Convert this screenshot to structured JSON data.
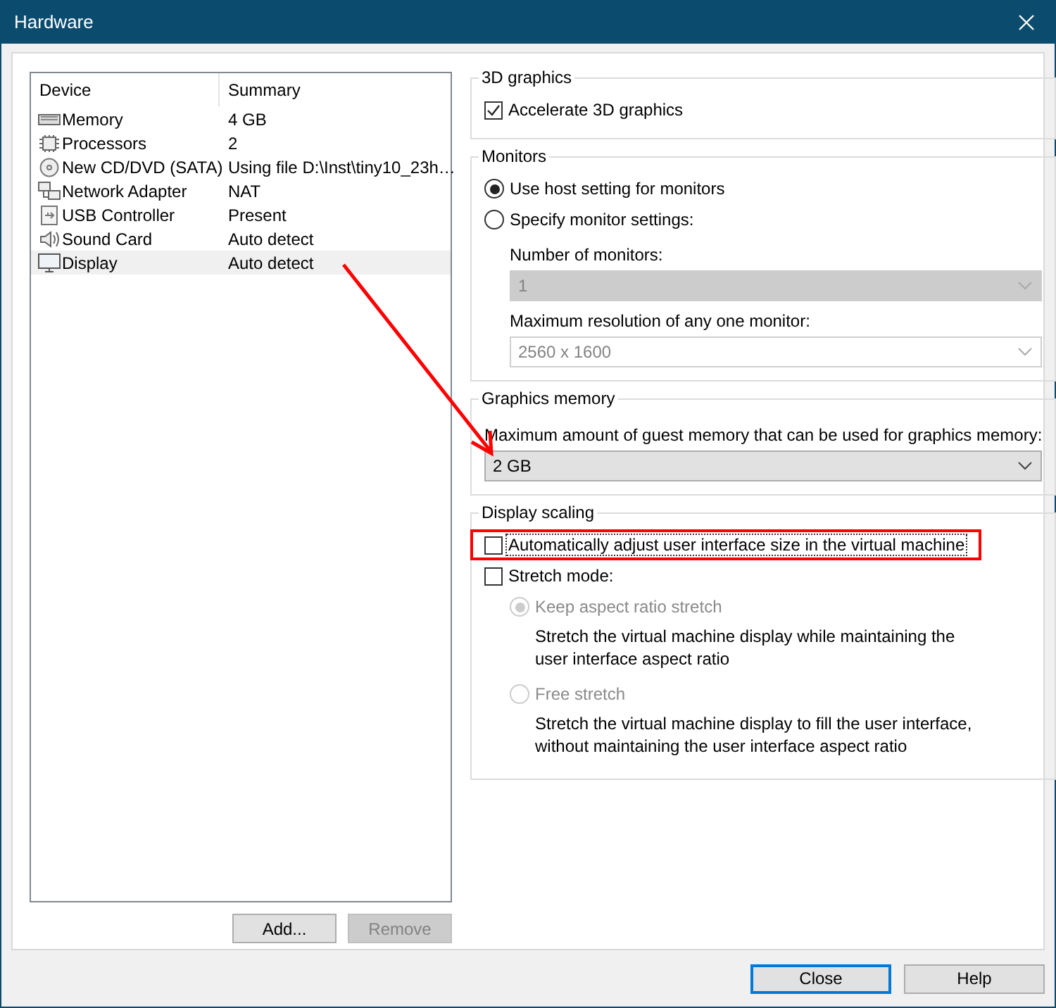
{
  "window": {
    "title": "Hardware"
  },
  "device_table": {
    "columns": [
      "Device",
      "Summary"
    ],
    "rows": [
      {
        "kind": "memory",
        "device": "Memory",
        "summary": "4 GB",
        "selected": false
      },
      {
        "kind": "processor",
        "device": "Processors",
        "summary": "2",
        "selected": false
      },
      {
        "kind": "disc",
        "device": "New CD/DVD (SATA)",
        "summary": "Using file D:\\Inst\\tiny10_23h…",
        "selected": false
      },
      {
        "kind": "network",
        "device": "Network Adapter",
        "summary": "NAT",
        "selected": false
      },
      {
        "kind": "usb",
        "device": "USB Controller",
        "summary": "Present",
        "selected": false
      },
      {
        "kind": "sound",
        "device": "Sound Card",
        "summary": "Auto detect",
        "selected": false
      },
      {
        "kind": "display",
        "device": "Display",
        "summary": "Auto detect",
        "selected": true
      }
    ]
  },
  "list_buttons": [
    {
      "label": "Add...",
      "disabled": false
    },
    {
      "label": "Remove",
      "disabled": true
    }
  ],
  "groups": [
    {
      "title": "3D graphics",
      "items": [
        {
          "kind": "checkbox",
          "label": "Accelerate 3D graphics",
          "checked": true
        }
      ]
    },
    {
      "title": "Monitors",
      "items": [
        {
          "kind": "radio",
          "label": "Use host setting for monitors",
          "selected": true,
          "disabled": false
        },
        {
          "kind": "radio",
          "label": "Specify monitor settings:",
          "selected": false,
          "disabled": false,
          "children": [
            {
              "kind": "label",
              "label": "Number of monitors:"
            },
            {
              "kind": "select",
              "value": "1",
              "disabled": true,
              "filled": true
            },
            {
              "kind": "label",
              "label": "Maximum resolution of any one monitor:"
            },
            {
              "kind": "select",
              "value": "2560 x 1600",
              "disabled": true,
              "filled": false
            }
          ]
        }
      ]
    },
    {
      "title": "Graphics memory",
      "items": [
        {
          "kind": "label",
          "label": "Maximum amount of guest memory that can be used for graphics memory:"
        },
        {
          "kind": "select",
          "value": "2 GB",
          "disabled": false,
          "filled": true
        }
      ]
    },
    {
      "title": "Display scaling",
      "items": [
        {
          "kind": "checkbox",
          "label": "Automatically adjust user interface size in the virtual machine",
          "checked": false,
          "focused": true,
          "highlighted": true
        },
        {
          "kind": "checkbox",
          "label": "Stretch mode:",
          "checked": false,
          "children": [
            {
              "kind": "radio",
              "label": "Keep aspect ratio stretch",
              "selected": true,
              "disabled": true,
              "children": [
                {
                  "kind": "note",
                  "label": "Stretch the virtual machine display while maintaining the user interface aspect ratio"
                }
              ]
            },
            {
              "kind": "radio",
              "label": "Free stretch",
              "selected": false,
              "disabled": true,
              "children": [
                {
                  "kind": "note",
                  "label": "Stretch the virtual machine display to fill the user interface, without maintaining the user interface aspect ratio"
                }
              ]
            }
          ]
        }
      ]
    }
  ],
  "dialog_buttons": [
    {
      "label": "Close",
      "default": true
    },
    {
      "label": "Help",
      "default": false
    }
  ],
  "annotations": [
    {
      "kind": "arrow"
    }
  ]
}
